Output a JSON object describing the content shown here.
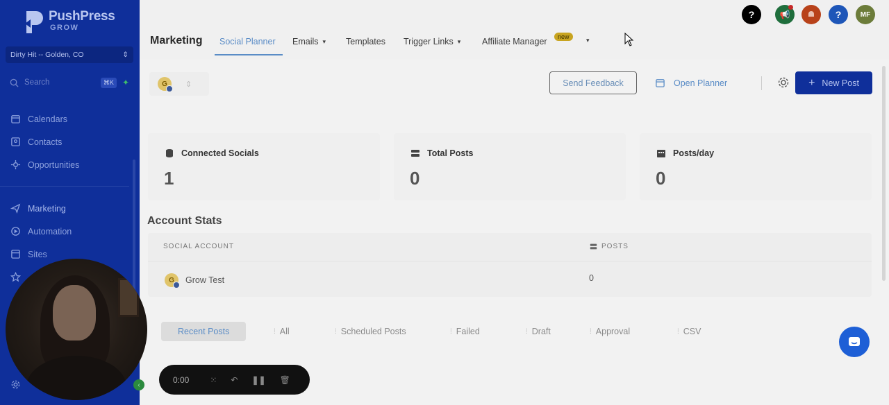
{
  "brand": {
    "name": "PushPress",
    "sub": "GROW"
  },
  "location": {
    "label": "Dirty Hit -- Golden, CO"
  },
  "search": {
    "placeholder": "Search",
    "shortcut": "⌘K"
  },
  "sidebar": {
    "items": [
      {
        "label": "Calendars",
        "icon": "calendar-icon"
      },
      {
        "label": "Contacts",
        "icon": "contacts-icon"
      },
      {
        "label": "Opportunities",
        "icon": "opportunities-icon"
      },
      {
        "label": "Marketing",
        "icon": "send-icon",
        "active": true
      },
      {
        "label": "Automation",
        "icon": "automation-icon"
      },
      {
        "label": "Sites",
        "icon": "globe-icon"
      }
    ]
  },
  "header": {
    "title": "Marketing",
    "tabs": [
      {
        "label": "Social Planner",
        "active": true
      },
      {
        "label": "Emails",
        "dropdown": true
      },
      {
        "label": "Templates"
      },
      {
        "label": "Trigger Links",
        "dropdown": true
      },
      {
        "label": "Affiliate Manager"
      }
    ],
    "new_badge": "new",
    "avatar_initials": "MF"
  },
  "toolbar": {
    "feedback_label": "Send Feedback",
    "planner_label": "Open Planner",
    "new_post_label": "New Post"
  },
  "account_switch": {
    "initial": "G"
  },
  "stats": [
    {
      "label": "Connected Socials",
      "value": "1"
    },
    {
      "label": "Total Posts",
      "value": "0"
    },
    {
      "label": "Posts/day",
      "value": "0"
    }
  ],
  "account_stats": {
    "title": "Account Stats",
    "columns": [
      "SOCIAL ACCOUNT",
      "POSTS"
    ],
    "rows": [
      {
        "account": "Grow Test",
        "initial": "G",
        "posts": "0"
      }
    ]
  },
  "post_tabs": [
    "Recent Posts",
    "All",
    "Scheduled Posts",
    "Failed",
    "Draft",
    "Approval",
    "CSV"
  ],
  "recorder": {
    "time": "0:00"
  },
  "colors": {
    "sidebar": "#0f2f9a",
    "accent": "#5a8cc6",
    "primary_button": "#0f2f9a",
    "chat": "#1e5fd6"
  }
}
